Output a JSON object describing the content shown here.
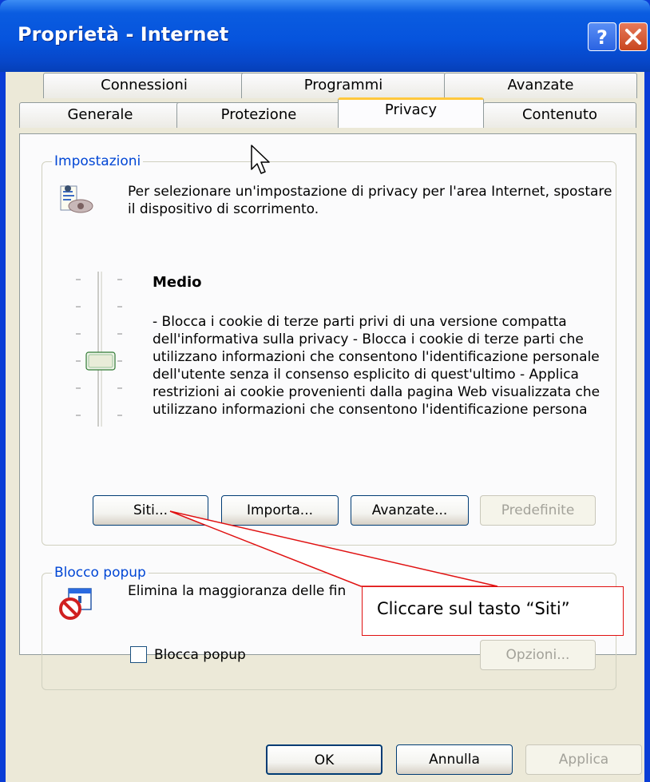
{
  "window": {
    "title": "Proprietà - Internet"
  },
  "tabs": {
    "row1": [
      "Connessioni",
      "Programmi",
      "Avanzate"
    ],
    "row2": [
      "Generale",
      "Protezione",
      "Privacy",
      "Contenuto"
    ],
    "active": "Privacy"
  },
  "impostazioni": {
    "group_label": "Impostazioni",
    "intro": "Per selezionare un'impostazione di privacy per l'area Internet, spostare il dispositivo di scorrimento.",
    "level_title": "Medio",
    "description": "- Blocca i cookie di terze parti privi di una versione compatta dell'informativa sulla privacy - Blocca i cookie di terze parti che utilizzano informazioni che consentono l'identificazione personale dell'utente senza il consenso esplicito di quest'ultimo - Applica restrizioni ai cookie provenienti dalla pagina Web visualizzata che utilizzano informazioni che consentono l'identificazione persona",
    "buttons": {
      "siti": "Siti...",
      "importa": "Importa...",
      "avanzate": "Avanzate...",
      "predefinite": "Predefinite"
    }
  },
  "popup": {
    "group_label": "Blocco popup",
    "text": "Elimina la maggioranza delle fin",
    "checkbox_label": "Blocca popup",
    "checkbox_checked": false,
    "opzioni": "Opzioni..."
  },
  "footer": {
    "ok": "OK",
    "annulla": "Annulla",
    "applica": "Applica"
  },
  "annotation": {
    "text": "Cliccare sul tasto “Siti”",
    "color": "#e01010"
  },
  "colors": {
    "title_bar": "#0654dd",
    "active_tab_accent": "#ffc83c",
    "group_label": "#0046d5"
  }
}
